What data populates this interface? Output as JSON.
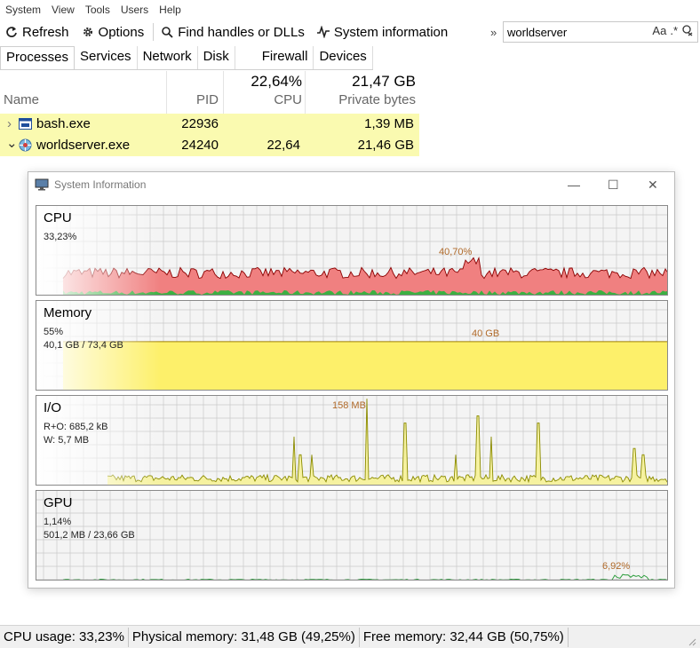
{
  "menu": [
    "System",
    "View",
    "Tools",
    "Users",
    "Help"
  ],
  "toolbar": {
    "refresh": "Refresh",
    "options": "Options",
    "find": "Find handles or DLLs",
    "sysinfo": "System information",
    "search_value": "worldserver",
    "case_label": "Aa",
    "regex_label": ".*"
  },
  "tabs": [
    "Processes",
    "Services",
    "Network",
    "Disk",
    "Firewall",
    "Devices"
  ],
  "table": {
    "headers": {
      "name": "Name",
      "pid": "PID",
      "cpu": "CPU",
      "private": "Private bytes"
    },
    "totals": {
      "cpu": "22,64%",
      "private": "21,47 GB"
    },
    "rows": [
      {
        "expander": "›",
        "name": "bash.exe",
        "pid": "22936",
        "cpu": "",
        "private": "1,39 MB"
      },
      {
        "expander": "⌄",
        "name": "worldserver.exe",
        "pid": "24240",
        "cpu": "22,64",
        "private": "21,46 GB"
      }
    ]
  },
  "sysinfo": {
    "title": "System Information",
    "cpu": {
      "title": "CPU",
      "line1": "33,23%",
      "peak_label": "40,70%"
    },
    "memory": {
      "title": "Memory",
      "line1": "55%",
      "line2": "40,1 GB / 73,4 GB",
      "peak_label": "40 GB",
      "fill_fraction": 0.55
    },
    "io": {
      "title": "I/O",
      "line1": "R+O: 685,2 kB",
      "line2": "W: 5,7 MB",
      "peak_label": "158 MB"
    },
    "gpu": {
      "title": "GPU",
      "line1": "1,14%",
      "line2": "501,2 MB / 23,66 GB",
      "peak_label": "6,92%"
    }
  },
  "status": {
    "cpu": "CPU usage: 33,23%",
    "physical": "Physical memory: 31,48 GB (49,25%)",
    "free": "Free memory: 32,44 GB (50,75%)"
  },
  "colors": {
    "cpu_fill": "#f08080",
    "cpu_line": "#8b0000",
    "cpu_kernel": "#3cb043",
    "memory_fill": "#fdf06a",
    "io_fill": "#f6f2a0",
    "io_line": "#8b8b00",
    "gpu_line": "#2e9e3e",
    "highlight": "#fafab0"
  }
}
